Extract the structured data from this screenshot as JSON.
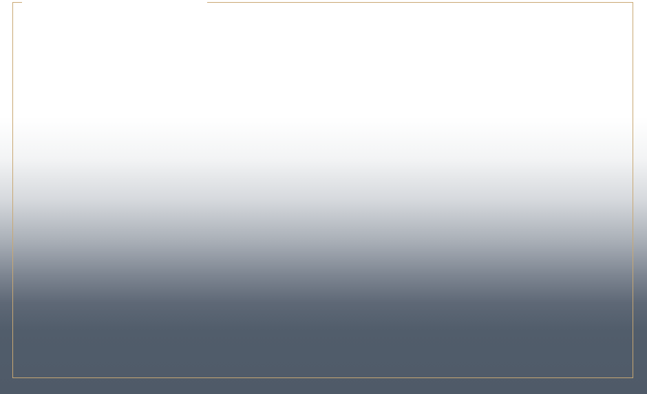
{
  "hero": {
    "background_top_color": "#ffffff",
    "background_bottom_color": "#4f5a68"
  },
  "frame": {
    "border_color": "#c9a873"
  }
}
